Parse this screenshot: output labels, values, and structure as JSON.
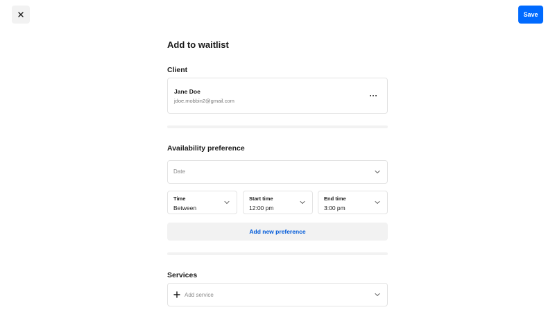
{
  "header": {
    "close_icon": "close-icon",
    "save_label": "Save"
  },
  "page": {
    "title": "Add to waitlist"
  },
  "client": {
    "section_label": "Client",
    "name": "Jane Doe",
    "email": "jdoe.mobbin2@gmail.com",
    "more_icon": "more-horizontal-icon"
  },
  "availability": {
    "section_label": "Availability preference",
    "date_placeholder": "Date",
    "time": {
      "label": "Time",
      "value": "Between"
    },
    "start_time": {
      "label": "Start time",
      "value": "12:00 pm"
    },
    "end_time": {
      "label": "End time",
      "value": "3:00 pm"
    },
    "add_preference_label": "Add new preference"
  },
  "services": {
    "section_label": "Services",
    "add_service_placeholder": "Add service"
  },
  "colors": {
    "accent": "#006aff",
    "link": "#005ad9",
    "border": "#e3e3e3",
    "muted_bg": "#f2f2f2"
  }
}
